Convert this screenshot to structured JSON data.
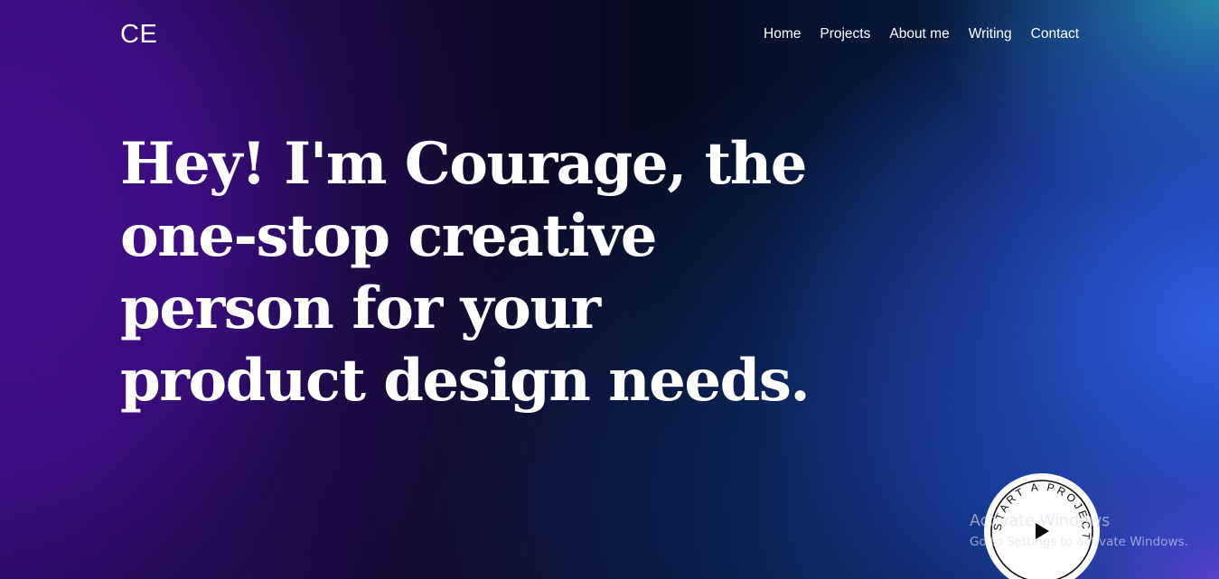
{
  "header": {
    "logo": "CE",
    "nav": [
      "Home",
      "Projects",
      "About me",
      "Writing",
      "Contact"
    ]
  },
  "hero": {
    "lines": [
      "Hey! I'm Courage, the",
      "one-stop creative",
      "person for your",
      "product design needs."
    ]
  },
  "cta": {
    "circular_text": "START A PROJECT",
    "icon": "play-icon"
  },
  "os_watermark": {
    "title": "Activate Windows",
    "subtitle": "Go to Settings to activate Windows."
  },
  "colors": {
    "text": "#ffffff",
    "purple": "#420e8c",
    "dark": "#060c1e",
    "blue": "#2d5fe0",
    "teal": "#2a9aa0"
  }
}
